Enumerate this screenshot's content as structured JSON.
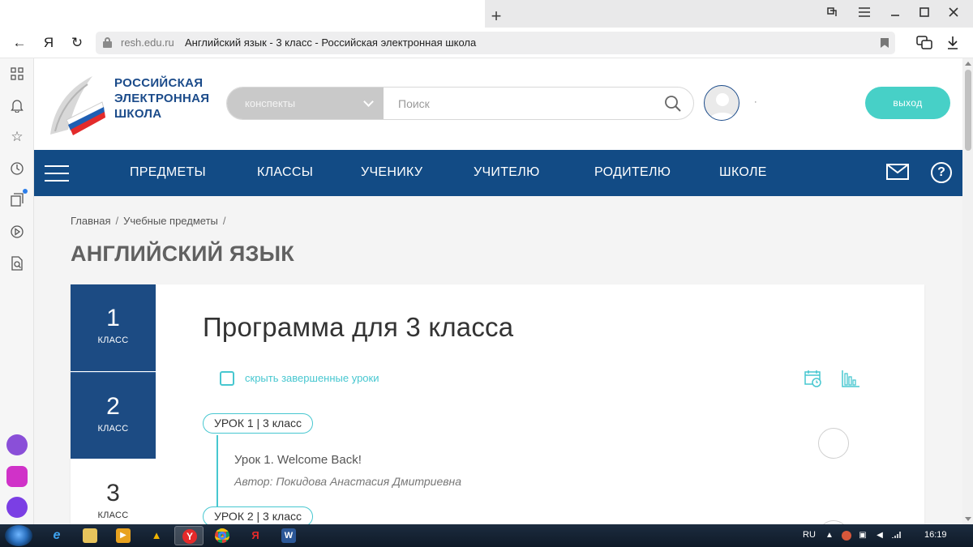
{
  "browser": {
    "url_domain": "resh.edu.ru",
    "url_title": "Английский язык - 3 класс - Российская электронная школа",
    "new_tab": "+",
    "back": "←",
    "yandex": "Я",
    "reload": "↻"
  },
  "site": {
    "logo_lines": [
      "РОССИЙСКАЯ",
      "ЭЛЕКТРОННАЯ",
      "ШКОЛА"
    ],
    "search_category": "конспекты",
    "search_placeholder": "Поиск",
    "user_name": "·",
    "logout_label": "выход"
  },
  "nav": {
    "items": [
      "ПРЕДМЕТЫ",
      "КЛАССЫ",
      "УЧЕНИКУ",
      "УЧИТЕЛЮ",
      "РОДИТЕЛЮ",
      "ШКОЛЕ"
    ],
    "help": "?"
  },
  "breadcrumb": [
    "Главная",
    "Учебные предметы"
  ],
  "breadcrumb_sep": "/",
  "page_title": "АНГЛИЙСКИЙ ЯЗЫК",
  "grades": [
    {
      "num": "1",
      "label": "КЛАСС",
      "active": false
    },
    {
      "num": "2",
      "label": "КЛАСС",
      "active": false
    },
    {
      "num": "3",
      "label": "КЛАСС",
      "active": true
    }
  ],
  "program": {
    "title": "Программа для 3 класса",
    "hide_completed_label": "скрыть завершенные уроки",
    "lessons": [
      {
        "badge": "УРОК 1 | 3 класс",
        "name": "Урок 1. Welcome Back!",
        "author": "Автор: Покидова Анастасия Дмитриевна"
      },
      {
        "badge": "УРОК 2 | 3 класс"
      }
    ]
  },
  "taskbar": {
    "lang": "RU",
    "clock": "16:19"
  },
  "colors": {
    "brand_blue": "#124b85",
    "accent_teal": "#47d0c7",
    "grade_blue": "#1c4b83"
  }
}
